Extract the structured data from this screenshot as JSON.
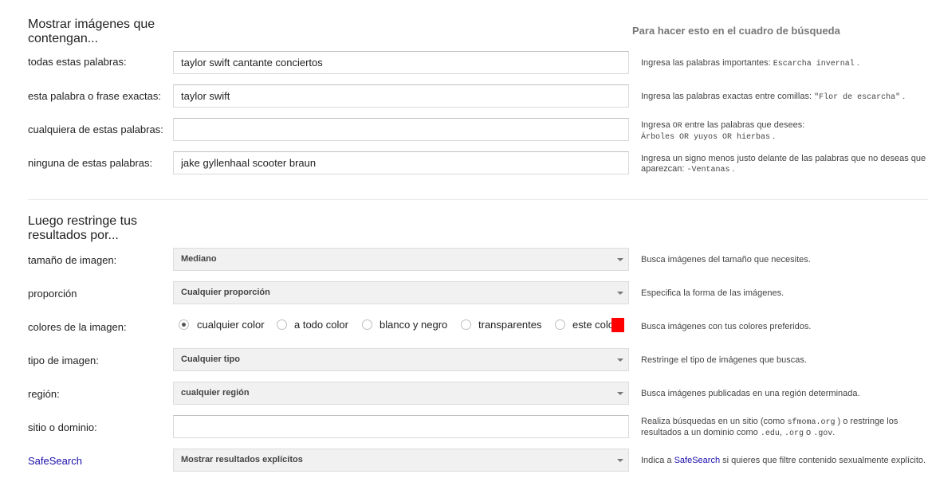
{
  "section1": {
    "title": "Mostrar imágenes que contengan...",
    "hint_header": "Para hacer esto en el cuadro de búsqueda",
    "rows": [
      {
        "label": "todas estas palabras:",
        "value": "taylor swift cantante conciertos",
        "help_text": "Ingresa las palabras importantes: ",
        "help_code": "Escarcha invernal",
        "help_end": " ."
      },
      {
        "label": "esta palabra o frase exactas:",
        "value": "taylor swift",
        "help_text": "Ingresa las palabras exactas entre comillas: ",
        "help_code": "\"Flor de escarcha\"",
        "help_end": " ."
      },
      {
        "label": "cualquiera de estas palabras:",
        "value": "",
        "help_l1_a": "Ingresa ",
        "help_l1_code": "OR",
        "help_l1_b": " entre las palabras que desees:",
        "help_l2_code": "Árboles OR yuyos OR hierbas",
        "help_l2_end": " ."
      },
      {
        "label": "ninguna de estas palabras:",
        "value": "jake gyllenhaal scooter braun",
        "help_text": "Ingresa un signo menos justo delante de las palabras que no deseas que aparezcan: ",
        "help_code": "-Ventanas",
        "help_end": " ."
      }
    ]
  },
  "section2": {
    "title": "Luego restringe tus resultados por...",
    "size": {
      "label": "tamaño de imagen:",
      "selected": "Mediano",
      "help": "Busca imágenes del tamaño que necesites."
    },
    "aspect": {
      "label": "proporción",
      "selected": "Cualquier proporción",
      "help": "Especifica la forma de las imágenes."
    },
    "colors": {
      "label": "colores de la imagen:",
      "options": [
        "cualquier color",
        "a todo color",
        "blanco y negro",
        "transparentes",
        "este color:"
      ],
      "selected_index": 0,
      "swatch_color": "#ff0000",
      "help": "Busca imágenes con tus colores preferidos."
    },
    "type": {
      "label": "tipo de imagen:",
      "selected": "Cualquier tipo",
      "help": "Restringe el tipo de imágenes que buscas."
    },
    "region": {
      "label": "región:",
      "selected": "cualquier región",
      "help": "Busca imágenes publicadas en una región determinada."
    },
    "site": {
      "label": "sitio o dominio:",
      "value": "",
      "help_a": "Realiza búsquedas en un sitio (como ",
      "help_code1": "sfmoma.org",
      "help_b": " ) o restringe los resultados a un dominio como ",
      "help_code2": ".edu",
      "help_c": ", ",
      "help_code3": ".org",
      "help_d": " o ",
      "help_code4": ".gov",
      "help_e": "."
    },
    "safesearch": {
      "label": "SafeSearch",
      "selected": "Mostrar resultados explícitos",
      "help_a": "Indica a ",
      "help_link": "SafeSearch",
      "help_b": " si quieres que filtre contenido sexualmente explícito."
    }
  }
}
